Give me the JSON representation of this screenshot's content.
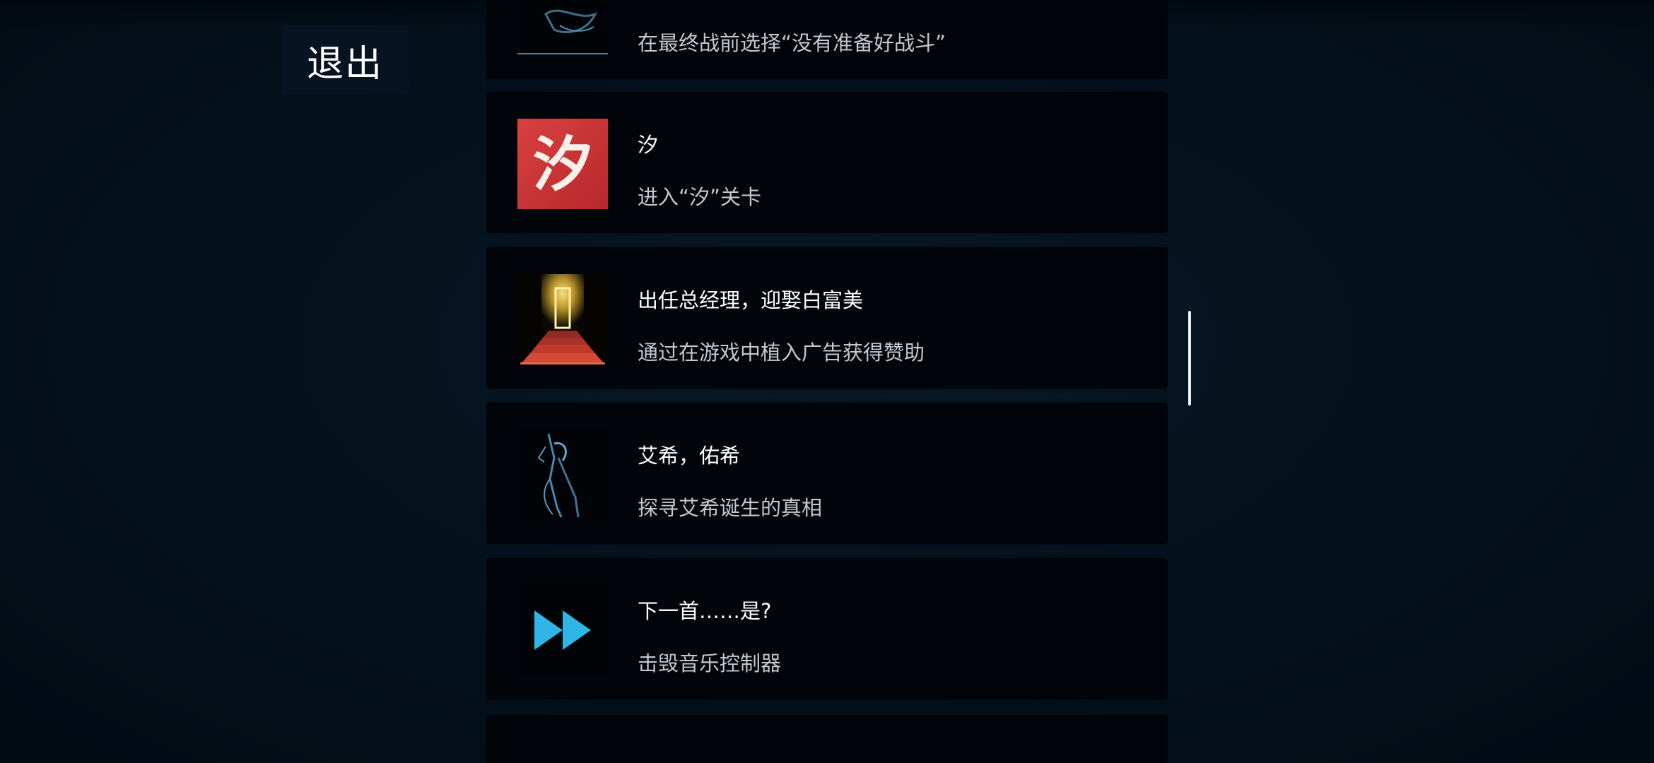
{
  "header": {
    "exit_label": "退出"
  },
  "achievements": [
    {
      "title": "",
      "description": "在最终战前选择“没有准备好战斗”",
      "icon": "blue-creature-icon"
    },
    {
      "title": "汐",
      "description": "进入“汐”关卡",
      "icon": "xi-calligraphy-icon",
      "icon_text": "汐"
    },
    {
      "title": "出任总经理，迎娶白富美",
      "description": "通过在游戏中植入广告获得赞助",
      "icon": "golden-door-red-stairs-icon"
    },
    {
      "title": "艾希，佑希",
      "description": "探寻艾希诞生的真相",
      "icon": "blue-scythe-icon"
    },
    {
      "title": "下一首……是?",
      "description": "击毁音乐控制器",
      "icon": "fast-forward-icon"
    }
  ],
  "colors": {
    "background": "#04121e",
    "card": "#010509",
    "title_text": "#ffffff",
    "desc_text": "#c4c8cc",
    "xi_red": "#d0353a",
    "fast_forward_cyan": "#2fb6e6",
    "gold": "#e8c64a",
    "stair_red": "#c0392b"
  }
}
